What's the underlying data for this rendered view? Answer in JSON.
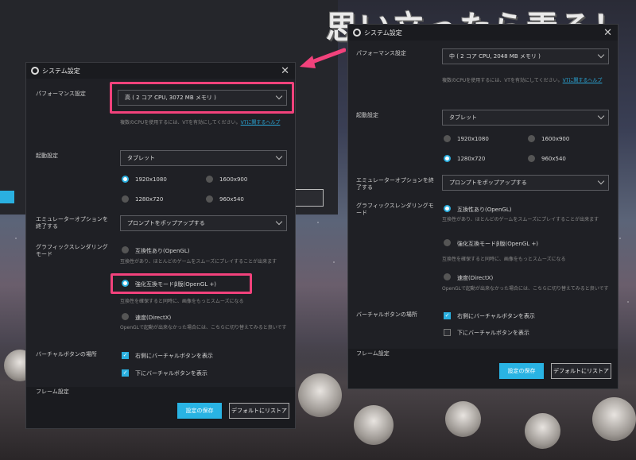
{
  "banner": "思い立ったら弄る！",
  "back_window": {
    "button_label": "ート"
  },
  "left": {
    "title": "システム設定",
    "performance_label": "パフォーマンス設定",
    "performance_value": "高 ( 2 コア CPU, 3072 MB メモリ )",
    "vt_hint": "複数のCPUを使用するには、VTを有効にしてください。",
    "vt_link": "VTに関するヘルプ",
    "boot_label": "起動設定",
    "boot_value": "タブレット",
    "res": [
      "1920x1080",
      "1600x900",
      "1280x720",
      "960x540"
    ],
    "exit_label": "エミュレーターオプションを終了する",
    "exit_value": "プロンプトをポップアップする",
    "gfx_label": "グラフィックスレンダリングモード",
    "gfx1": "互換性あり(OpenGL)",
    "gfx1_hint": "互換性があり、ほとんどのゲームをスムーズにプレイすることが出来ます",
    "gfx2": "強化互換モードβ版(OpenGL +)",
    "gfx2_hint": "互換性を確保すると同時に、画像をもっとスムーズになる",
    "gfx3": "速度(DirectX)",
    "gfx3_hint": "OpenGLで起動が出来なかった場合には、こちらに切り替えてみると良いです",
    "vbtn_label": "バーチャルボタンの場所",
    "vbtn1": "右側にバーチャルボタンを表示",
    "vbtn2": "下にバーチャルボタンを表示",
    "frame_label": "フレーム設定",
    "save": "設定の保存",
    "reset": "デフォルトにリストア"
  },
  "right": {
    "title": "システム設定",
    "performance_label": "パフォーマンス設定",
    "performance_value": "中 ( 2 コア CPU, 2048 MB メモリ )",
    "vt_hint": "複数のCPUを使用するには、VTを有効にしてください。",
    "vt_link": "VTに関するヘルプ",
    "boot_label": "起動設定",
    "boot_value": "タブレット",
    "res": [
      "1920x1080",
      "1600x900",
      "1280x720",
      "960x540"
    ],
    "exit_label": "エミュレーターオプションを終了する",
    "exit_value": "プロンプトをポップアップする",
    "gfx_label": "グラフィックスレンダリングモード",
    "gfx1": "互換性あり(OpenGL)",
    "gfx1_hint": "互換性があり、ほとんどのゲームをスムーズにプレイすることが出来ます",
    "gfx2": "強化互換モードβ版(OpenGL +)",
    "gfx2_hint": "互換性を確保すると同時に、画像をもっとスムーズになる",
    "gfx3": "速度(DirectX)",
    "gfx3_hint": "OpenGLで起動が出来なかった場合には、こちらに切り替えてみると良いです",
    "vbtn_label": "バーチャルボタンの場所",
    "vbtn1": "右側にバーチャルボタンを表示",
    "vbtn2": "下にバーチャルボタンを表示",
    "frame_label": "フレーム設定",
    "save": "設定の保存",
    "reset": "デフォルトにリストア"
  },
  "colors": {
    "accent": "#29b3e3",
    "highlight": "#f2427c",
    "dialog_bg": "#1f2025"
  }
}
